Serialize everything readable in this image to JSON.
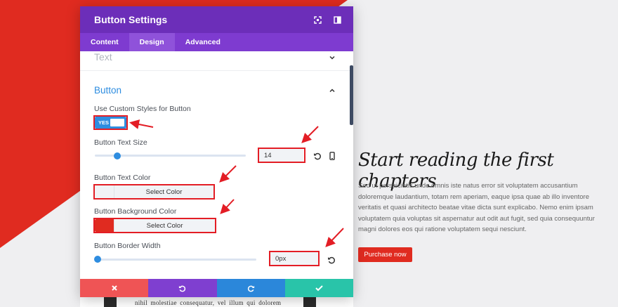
{
  "modal": {
    "title": "Button Settings",
    "tabs": [
      {
        "label": "Content",
        "active": false
      },
      {
        "label": "Design",
        "active": true
      },
      {
        "label": "Advanced",
        "active": false
      }
    ],
    "sections": {
      "text": "Text",
      "button": "Button"
    },
    "custom_styles": {
      "label": "Use Custom Styles for Button",
      "toggle_text": "YES",
      "enabled": true
    },
    "text_size": {
      "label": "Button Text Size",
      "value": "14"
    },
    "text_color": {
      "label": "Button Text Color",
      "picker_label": "Select Color",
      "swatch": "#f1f3f6"
    },
    "bg_color": {
      "label": "Button Background Color",
      "picker_label": "Select Color",
      "swatch": "#e02b20"
    },
    "border_width": {
      "label": "Button Border Width",
      "value": "0px"
    },
    "footer": {
      "discard_icon": "x-icon",
      "undo_icon": "undo-icon",
      "redo_icon": "redo-icon",
      "save_icon": "check-icon"
    }
  },
  "page": {
    "heading": "Start reading the first chapters",
    "body": "Sed ut perspiciatis unde omnis iste natus error sit voluptatem accusantium doloremque laudantium, totam rem aperiam, eaque ipsa quae ab illo inventore veritatis et quasi architecto beatae vitae dicta sunt explicabo. Nemo enim ipsam voluptatem quia voluptas sit aspernatur aut odit aut fugit, sed quia consequuntur magni dolores eos qui ratione voluptatem sequi nesciunt.",
    "button": "Purchase now",
    "bottom_text": "nihil molestiae consequatur, vel illum qui dolorem"
  },
  "colors": {
    "header": "#6c2eb9",
    "tabs": "#7e3bd0",
    "accent": "#2e8de0",
    "annotation": "#e31d25",
    "brand_red": "#e02b20",
    "footer_discard": "#ef5455",
    "footer_undo": "#7f3fd0",
    "footer_redo": "#2b87da",
    "footer_save": "#29c4a9"
  }
}
